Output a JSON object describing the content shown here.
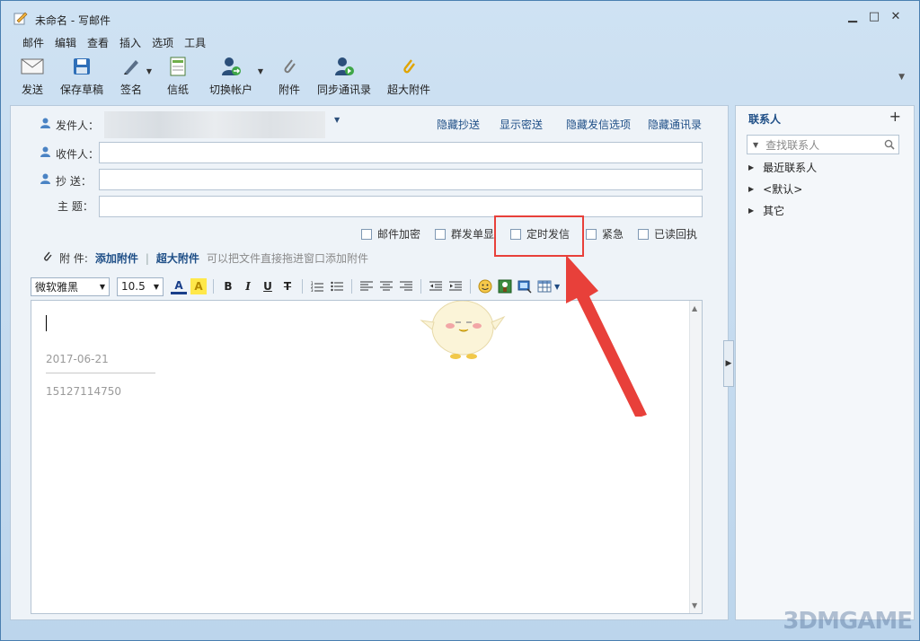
{
  "window": {
    "title": "未命名 - 写邮件",
    "minimize": "▁",
    "maximize": "□",
    "close": "✕"
  },
  "menu": [
    "邮件",
    "编辑",
    "查看",
    "插入",
    "选项",
    "工具"
  ],
  "toolbar": {
    "send": "发送",
    "save_draft": "保存草稿",
    "signature": "签名",
    "stationery": "信纸",
    "switch_account": "切换帐户",
    "attachment": "附件",
    "sync_contacts": "同步通讯录",
    "large_attachment": "超大附件"
  },
  "compose": {
    "from_label": "发件人：",
    "to_label": "收件人：",
    "cc_label": "抄  送：",
    "subject_label": "主  题：",
    "links": {
      "hide_cc": "隐藏抄送",
      "show_bcc": "显示密送",
      "hide_send_options": "隐藏发信选项",
      "hide_contacts": "隐藏通讯录"
    },
    "options": {
      "encrypt": "邮件加密",
      "separate_send": "群发单显",
      "scheduled_send": "定时发信",
      "urgent": "紧急",
      "read_receipt": "已读回执"
    },
    "attach": {
      "label": "附  件:",
      "add": "添加附件",
      "large": "超大附件",
      "hint": "可以把文件直接拖进窗口添加附件"
    }
  },
  "format": {
    "font": "微软雅黑",
    "size": "10.5"
  },
  "editor": {
    "sig_date": "2017-06-21",
    "sig_phone": "15127114750"
  },
  "sidebar": {
    "title": "联系人",
    "add": "+",
    "search_placeholder": "查找联系人",
    "groups": [
      "最近联系人",
      "<默认>",
      "其它"
    ]
  },
  "watermark": "3DMGAME"
}
